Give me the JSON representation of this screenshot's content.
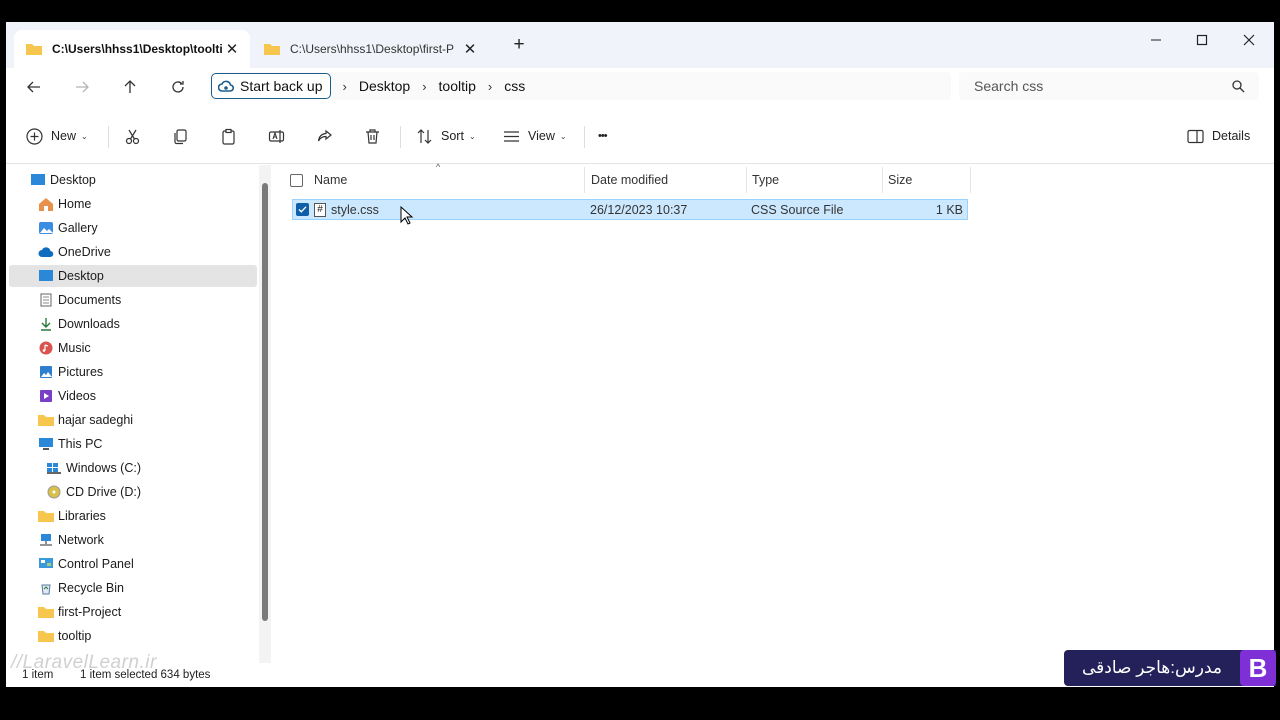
{
  "tabs": [
    {
      "label": "C:\\Users\\hhss1\\Desktop\\toolti",
      "close": "✕"
    },
    {
      "label": "C:\\Users\\hhss1\\Desktop\\first-P",
      "close": "✕"
    }
  ],
  "new_tab": "+",
  "address": {
    "backup_label": "Start back up",
    "crumbs": [
      "Desktop",
      "tooltip",
      "css"
    ],
    "separator": "›"
  },
  "search": {
    "placeholder": "Search css"
  },
  "commands": {
    "new": "New",
    "sort": "Sort",
    "view": "View",
    "more": "•••",
    "details": "Details",
    "caret": "⌄"
  },
  "sidebar": {
    "items": [
      {
        "label": "Desktop",
        "icon": "desktop-icon"
      },
      {
        "label": "Home",
        "icon": "home-icon"
      },
      {
        "label": "Gallery",
        "icon": "gallery-icon"
      },
      {
        "label": "OneDrive",
        "icon": "cloud-icon"
      },
      {
        "label": "Desktop",
        "icon": "desktop-icon"
      },
      {
        "label": "Documents",
        "icon": "documents-icon"
      },
      {
        "label": "Downloads",
        "icon": "download-icon"
      },
      {
        "label": "Music",
        "icon": "music-icon"
      },
      {
        "label": "Pictures",
        "icon": "pictures-icon"
      },
      {
        "label": "Videos",
        "icon": "videos-icon"
      },
      {
        "label": "hajar sadeghi",
        "icon": "folder-icon"
      },
      {
        "label": "This PC",
        "icon": "pc-icon"
      },
      {
        "label": "Windows (C:)",
        "icon": "drive-icon"
      },
      {
        "label": "CD Drive (D:)",
        "icon": "cd-icon"
      },
      {
        "label": "Libraries",
        "icon": "folder-icon"
      },
      {
        "label": "Network",
        "icon": "network-icon"
      },
      {
        "label": "Control Panel",
        "icon": "control-panel-icon"
      },
      {
        "label": "Recycle Bin",
        "icon": "recycle-bin-icon"
      },
      {
        "label": "first-Project",
        "icon": "folder-icon"
      },
      {
        "label": "tooltip",
        "icon": "folder-icon"
      }
    ]
  },
  "columns": {
    "name": "Name",
    "date": "Date modified",
    "type": "Type",
    "size": "Size",
    "sort_indicator": "^"
  },
  "files": [
    {
      "icon": "#",
      "name": "style.css",
      "date": "26/12/2023 10:37",
      "type": "CSS Source File",
      "size": "1 KB",
      "selected": true
    }
  ],
  "status": {
    "count": "1 item",
    "selected": "1 item selected  634 bytes"
  },
  "overlay": {
    "watermark": "//LaravelLearn.ir",
    "teacher": "مدرس:هاجر صادقی",
    "logo": "B"
  },
  "colors": {
    "accent": "#0f5fa8",
    "selection": "#cce8ff",
    "folder": "#f6c64f"
  }
}
